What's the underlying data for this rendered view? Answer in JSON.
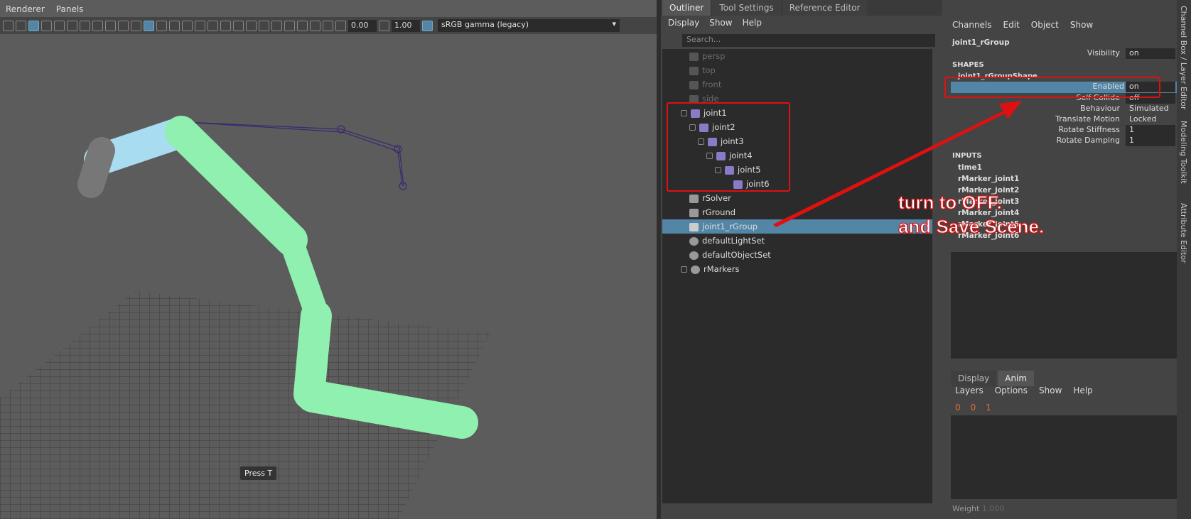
{
  "viewport": {
    "menu": [
      "Renderer",
      "Panels"
    ],
    "exposure": "0.00",
    "gamma": "1.00",
    "color_space": "sRGB gamma (legacy)",
    "hint": "Press T"
  },
  "outliner": {
    "tabs": [
      "Outliner",
      "Tool Settings",
      "Reference Editor"
    ],
    "menu": [
      "Display",
      "Show",
      "Help"
    ],
    "search_placeholder": "Search...",
    "items": [
      {
        "label": "persp",
        "dim": true
      },
      {
        "label": "top",
        "dim": true
      },
      {
        "label": "front",
        "dim": true
      },
      {
        "label": "side",
        "dim": true
      },
      {
        "label": "joint1"
      },
      {
        "label": "joint2"
      },
      {
        "label": "joint3"
      },
      {
        "label": "joint4"
      },
      {
        "label": "joint5"
      },
      {
        "label": "joint6"
      },
      {
        "label": "rSolver"
      },
      {
        "label": "rGround"
      },
      {
        "label": "joint1_rGroup",
        "selected": true
      },
      {
        "label": "defaultLightSet"
      },
      {
        "label": "defaultObjectSet"
      },
      {
        "label": "rMarkers"
      }
    ]
  },
  "channelbox": {
    "menu": [
      "Channels",
      "Edit",
      "Object",
      "Show"
    ],
    "node": "joint1_rGroup",
    "visibility_label": "Visibility",
    "visibility_value": "on",
    "shapes_header": "SHAPES",
    "shape_name": "joint1_rGroupShape",
    "attrs": [
      {
        "name": "Enabled",
        "value": "on"
      },
      {
        "name": "Self Collide",
        "value": "off"
      },
      {
        "name": "Behaviour",
        "value": "Simulated"
      },
      {
        "name": "Translate Motion",
        "value": "Locked"
      },
      {
        "name": "Rotate Stiffness",
        "value": "1"
      },
      {
        "name": "Rotate Damping",
        "value": "1"
      }
    ],
    "inputs_header": "INPUTS",
    "inputs": [
      "time1",
      "rMarker_joint1",
      "rMarker_joint2",
      "rMarker_joint3",
      "rMarker_joint4",
      "rMarker_joint5",
      "rMarker_joint6"
    ]
  },
  "layers": {
    "tabs": [
      "Display",
      "Anim"
    ],
    "menu": [
      "Layers",
      "Options",
      "Show",
      "Help"
    ],
    "counters": [
      "0",
      "0",
      "1"
    ],
    "weight_label": "Weight",
    "weight_value": "1.000"
  },
  "side_tabs": [
    "Channel Box / Layer Editor",
    "Modeling Toolkit",
    "Attribute Editor"
  ],
  "annotation": {
    "line1": "turn to OFF.",
    "line2": "and Save Scene."
  },
  "colors": {
    "selection": "#5285a6",
    "annotation": "#e01010",
    "limb": "#8ff0b0",
    "limb_selected": "#a8dcf0"
  }
}
